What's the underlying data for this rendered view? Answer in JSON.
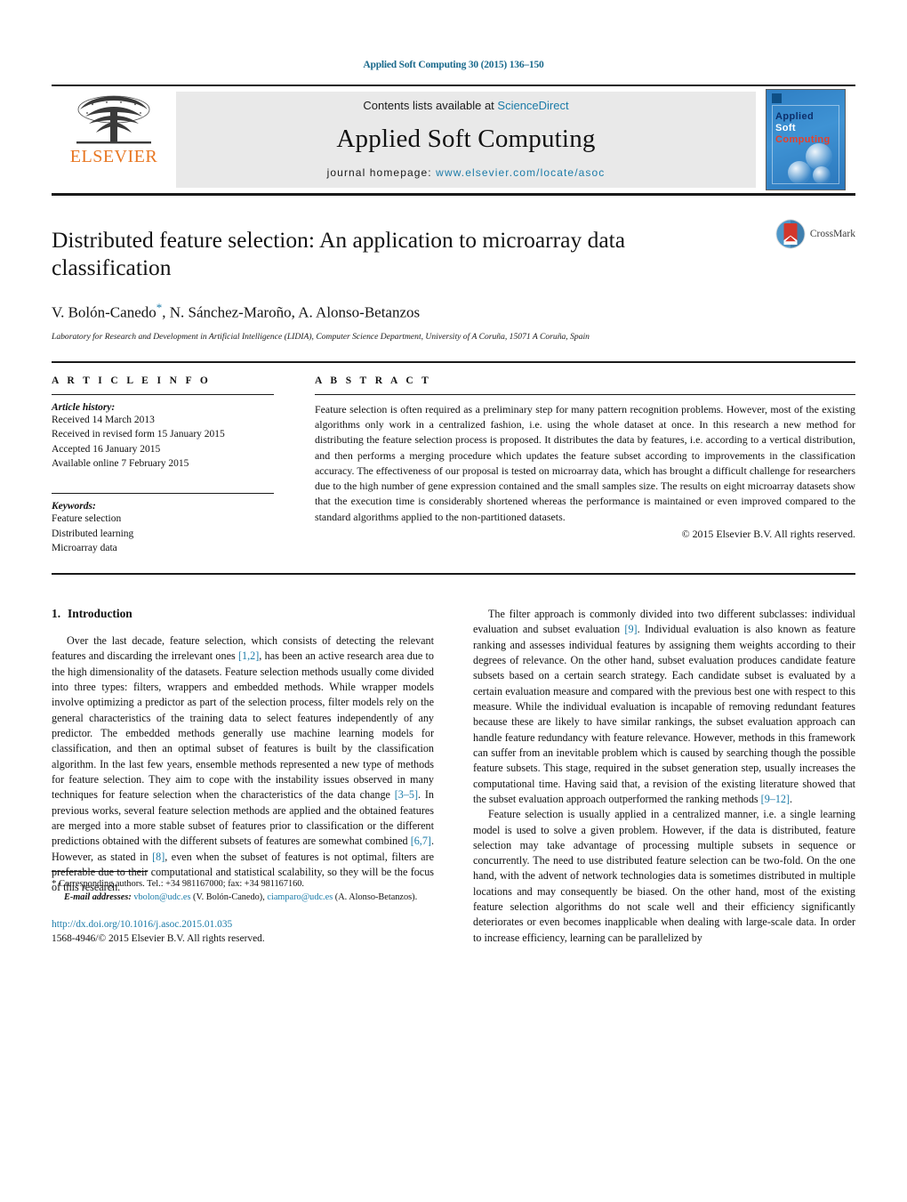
{
  "running_head": "Applied Soft Computing 30 (2015) 136–150",
  "masthead": {
    "publisher_name": "ELSEVIER",
    "contents_prefix": "Contents lists available at ",
    "contents_link": "ScienceDirect",
    "journal_name": "Applied Soft Computing",
    "homepage_prefix": "journal homepage: ",
    "homepage_url": "www.elsevier.com/locate/asoc",
    "cover": {
      "line1": "Applied",
      "line2": "Soft",
      "line3": "Computing"
    }
  },
  "article": {
    "title": "Distributed feature selection: An application to microarray data classification",
    "authors": "V. Bolón-Canedo",
    "authors_rest": ", N. Sánchez-Maroño, A. Alonso-Betanzos",
    "corresponding_marker": "*",
    "affiliation": "Laboratory for Research and Development in Artificial Intelligence (LIDIA), Computer Science Department, University of A Coruña, 15071 A Coruña, Spain",
    "crossmark_label": "CrossMark"
  },
  "info": {
    "heading": "A R T I C L E   I N F O",
    "history_label": "Article history:",
    "history": [
      "Received 14 March 2013",
      "Received in revised form 15 January 2015",
      "Accepted 16 January 2015",
      "Available online 7 February 2015"
    ],
    "keywords_label": "Keywords:",
    "keywords": [
      "Feature selection",
      "Distributed learning",
      "Microarray data"
    ]
  },
  "abstract": {
    "heading": "A B S T R A C T",
    "text": "Feature selection is often required as a preliminary step for many pattern recognition problems. However, most of the existing algorithms only work in a centralized fashion, i.e. using the whole dataset at once. In this research a new method for distributing the feature selection process is proposed. It distributes the data by features, i.e. according to a vertical distribution, and then performs a merging procedure which updates the feature subset according to improvements in the classification accuracy. The effectiveness of our proposal is tested on microarray data, which has brought a difficult challenge for researchers due to the high number of gene expression contained and the small samples size. The results on eight microarray datasets show that the execution time is considerably shortened whereas the performance is maintained or even improved compared to the standard algorithms applied to the non-partitioned datasets.",
    "copyright": "© 2015 Elsevier B.V. All rights reserved."
  },
  "body": {
    "section_number": "1.",
    "section_title": "Introduction",
    "left_paragraphs": [
      {
        "parts": [
          {
            "t": "Over the last decade, feature selection, which consists of detecting the relevant features and discarding the irrelevant ones "
          },
          {
            "t": "[1,2]",
            "ref": true
          },
          {
            "t": ", has been an active research area due to the high dimensionality of the datasets. Feature selection methods usually come divided into three types: filters, wrappers and embedded methods. While wrapper models involve optimizing a predictor as part of the selection process, filter models rely on the general characteristics of the training data to select features independently of any predictor. The embedded methods generally use machine learning models for classification, and then an optimal subset of features is built by the classification algorithm. In the last few years, ensemble methods represented a new type of methods for feature selection. They aim to cope with the instability issues observed in many techniques for feature selection when the characteristics of the data change "
          },
          {
            "t": "[3–5]",
            "ref": true
          },
          {
            "t": ". In previous works, several feature selection methods are applied and the obtained features are merged into a more stable subset of features prior to classification or the different predictions obtained with the different subsets of features are somewhat combined "
          },
          {
            "t": "[6,7]",
            "ref": true
          },
          {
            "t": ". However, as stated in "
          },
          {
            "t": "[8]",
            "ref": true
          },
          {
            "t": ", even when the subset of features is not optimal, filters are preferable due to their computational and statistical scalability, so they will be the focus of this research."
          }
        ]
      }
    ],
    "right_paragraphs": [
      {
        "parts": [
          {
            "t": "The filter approach is commonly divided into two different subclasses: individual evaluation and subset evaluation "
          },
          {
            "t": "[9]",
            "ref": true
          },
          {
            "t": ". Individual evaluation is also known as feature ranking and assesses individual features by assigning them weights according to their degrees of relevance. On the other hand, subset evaluation produces candidate feature subsets based on a certain search strategy. Each candidate subset is evaluated by a certain evaluation measure and compared with the previous best one with respect to this measure. While the individual evaluation is incapable of removing redundant features because these are likely to have similar rankings, the subset evaluation approach can handle feature redundancy with feature relevance. However, methods in this framework can suffer from an inevitable problem which is caused by searching though the possible feature subsets. This stage, required in the subset generation step, usually increases the computational time. Having said that, a revision of the existing literature showed that the subset evaluation approach outperformed the ranking methods "
          },
          {
            "t": "[9–12]",
            "ref": true
          },
          {
            "t": "."
          }
        ]
      },
      {
        "parts": [
          {
            "t": "Feature selection is usually applied in a centralized manner, i.e. a single learning model is used to solve a given problem. However, if the data is distributed, feature selection may take advantage of processing multiple subsets in sequence or concurrently. The need to use distributed feature selection can be two-fold. On the one hand, with the advent of network technologies data is sometimes distributed in multiple locations and may consequently be biased. On the other hand, most of the existing feature selection algorithms do not scale well and their efficiency significantly deteriorates or even becomes inapplicable when dealing with large-scale data. In order to increase efficiency, learning can be parallelized by"
          }
        ]
      }
    ]
  },
  "footnotes": {
    "corresponding_star": "*",
    "corresponding_text": " Corresponding authors. Tel.: +34 981167000; fax: +34 981167160.",
    "email_label": "E-mail addresses:",
    "email_1": "vbolon@udc.es",
    "email_1_name": " (V. Bolón-Canedo), ",
    "email_2": "ciamparo@udc.es",
    "email_2_name": "(A. Alonso-Betanzos).",
    "doi": "http://dx.doi.org/10.1016/j.asoc.2015.01.035",
    "issn": "1568-4946/© 2015 Elsevier B.V. All rights reserved."
  }
}
